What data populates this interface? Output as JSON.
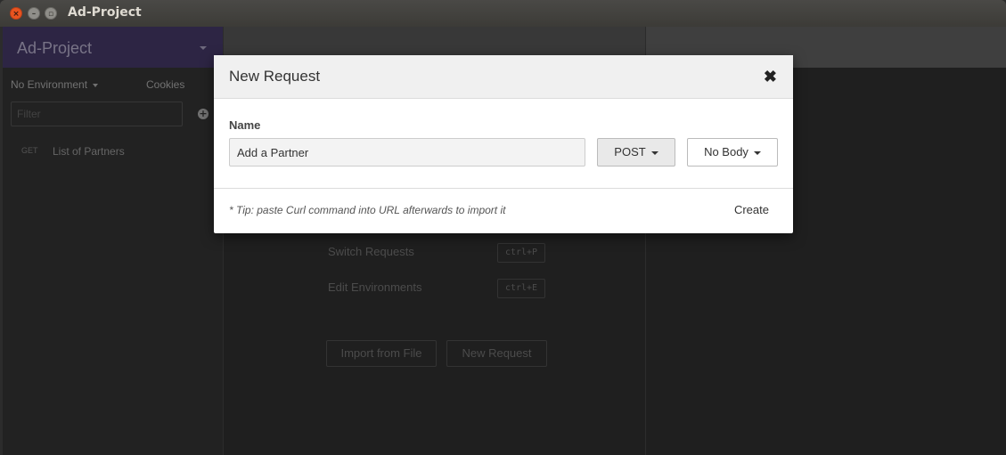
{
  "window": {
    "title": "Ad-Project"
  },
  "sidebar": {
    "workspace": "Ad-Project",
    "environment": "No Environment",
    "cookies": "Cookies",
    "filter_placeholder": "Filter",
    "requests": [
      {
        "method": "GET",
        "name": "List of Partners"
      }
    ]
  },
  "main": {
    "shortcuts": [
      {
        "label": "Switch Requests",
        "keys": "ctrl+P"
      },
      {
        "label": "Edit Environments",
        "keys": "ctrl+E"
      }
    ],
    "import_button": "Import from File",
    "new_request_button": "New Request"
  },
  "modal": {
    "title": "New Request",
    "close_glyph": "✖",
    "name_label": "Name",
    "name_value": "Add a Partner",
    "method": "POST",
    "body_type": "No Body",
    "tip": "* Tip: paste Curl command into URL afterwards to import it",
    "create": "Create"
  }
}
